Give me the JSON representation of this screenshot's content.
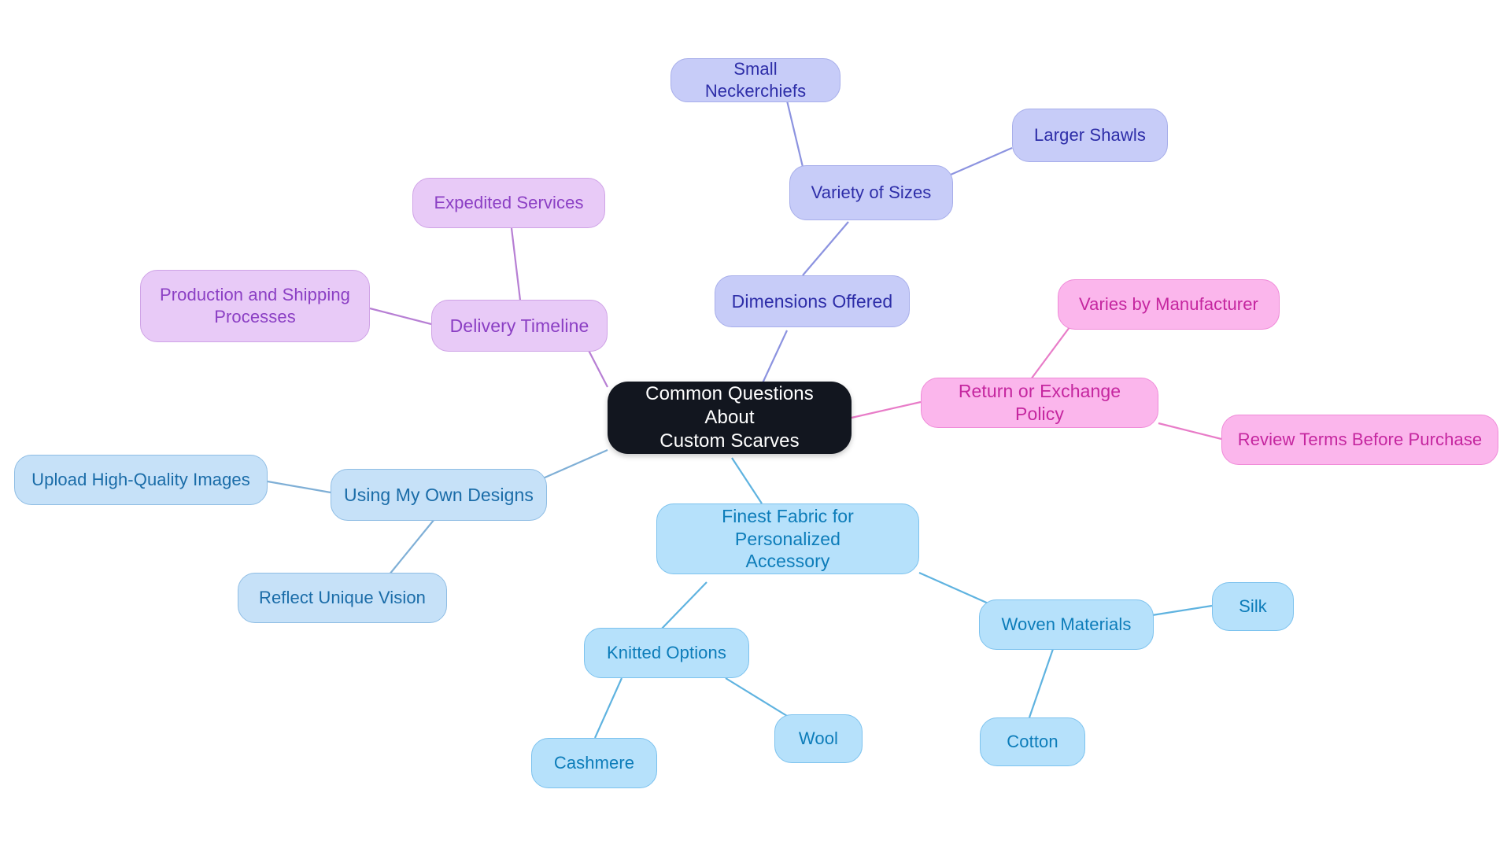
{
  "diagram": {
    "type": "mindmap",
    "title": "Common Questions About Custom Scarves",
    "background": "#ffffff",
    "palette": {
      "root_fill": "#12161f",
      "root_text": "#ffffff",
      "periwinkle_fill": "#c7ccf8",
      "periwinkle_text": "#2d2da8",
      "purple_fill": "#e8caf7",
      "purple_text": "#8b3fc4",
      "pink_fill": "#fbb6ec",
      "pink_text": "#c5269f",
      "blue_fill": "#c6e1f8",
      "blue_text": "#1a6ca8",
      "cyan_fill": "#b6e1fb",
      "cyan_text": "#0c7cb9"
    }
  },
  "nodes": {
    "root": {
      "label": "Common Questions About\nCustom Scarves"
    },
    "small_neckerchiefs": {
      "label": "Small Neckerchiefs"
    },
    "larger_shawls": {
      "label": "Larger Shawls"
    },
    "variety_of_sizes": {
      "label": "Variety of Sizes"
    },
    "dimensions_offered": {
      "label": "Dimensions Offered"
    },
    "expedited_services": {
      "label": "Expedited Services"
    },
    "production_shipping": {
      "label": "Production and Shipping\nProcesses"
    },
    "delivery_timeline": {
      "label": "Delivery Timeline"
    },
    "varies_by_manufacturer": {
      "label": "Varies by Manufacturer"
    },
    "return_exchange_policy": {
      "label": "Return or Exchange Policy"
    },
    "review_terms": {
      "label": "Review Terms Before Purchase"
    },
    "upload_images": {
      "label": "Upload High-Quality Images"
    },
    "own_designs": {
      "label": "Using My Own Designs"
    },
    "reflect_vision": {
      "label": "Reflect Unique Vision"
    },
    "finest_fabric": {
      "label": "Finest Fabric for Personalized\nAccessory"
    },
    "knitted_options": {
      "label": "Knitted Options"
    },
    "cashmere": {
      "label": "Cashmere"
    },
    "wool": {
      "label": "Wool"
    },
    "woven_materials": {
      "label": "Woven Materials"
    },
    "silk": {
      "label": "Silk"
    },
    "cotton": {
      "label": "Cotton"
    }
  },
  "branches": [
    {
      "name": "dimensions",
      "color": "#8c93e0",
      "root_child": "dimensions_offered",
      "children": [
        "variety_of_sizes"
      ],
      "grandchildren": [
        "small_neckerchiefs",
        "larger_shawls"
      ]
    },
    {
      "name": "delivery",
      "color": "#b77fd4",
      "root_child": "delivery_timeline",
      "children": [
        "expedited_services",
        "production_shipping"
      ],
      "grandchildren": []
    },
    {
      "name": "returns",
      "color": "#e87cc8",
      "root_child": "return_exchange_policy",
      "children": [
        "varies_by_manufacturer",
        "review_terms"
      ],
      "grandchildren": []
    },
    {
      "name": "designs",
      "color": "#7fafd6",
      "root_child": "own_designs",
      "children": [
        "upload_images",
        "reflect_vision"
      ],
      "grandchildren": []
    },
    {
      "name": "fabric",
      "color": "#5fb3e0",
      "root_child": "finest_fabric",
      "children": [
        "knitted_options",
        "woven_materials"
      ],
      "grandchildren": [
        "cashmere",
        "wool",
        "silk",
        "cotton"
      ]
    }
  ],
  "edges": [
    {
      "from": "root",
      "to": "delivery_timeline",
      "color": "#b77fd4"
    },
    {
      "from": "delivery_timeline",
      "to": "expedited_services",
      "color": "#b77fd4"
    },
    {
      "from": "delivery_timeline",
      "to": "production_shipping",
      "color": "#b77fd4"
    },
    {
      "from": "root",
      "to": "dimensions_offered",
      "color": "#8c93e0"
    },
    {
      "from": "dimensions_offered",
      "to": "variety_of_sizes",
      "color": "#8c93e0"
    },
    {
      "from": "variety_of_sizes",
      "to": "small_neckerchiefs",
      "color": "#8c93e0"
    },
    {
      "from": "variety_of_sizes",
      "to": "larger_shawls",
      "color": "#8c93e0"
    },
    {
      "from": "root",
      "to": "return_exchange_policy",
      "color": "#e87cc8"
    },
    {
      "from": "return_exchange_policy",
      "to": "varies_by_manufacturer",
      "color": "#e87cc8"
    },
    {
      "from": "return_exchange_policy",
      "to": "review_terms",
      "color": "#e87cc8"
    },
    {
      "from": "root",
      "to": "own_designs",
      "color": "#7fafd6"
    },
    {
      "from": "own_designs",
      "to": "upload_images",
      "color": "#7fafd6"
    },
    {
      "from": "own_designs",
      "to": "reflect_vision",
      "color": "#7fafd6"
    },
    {
      "from": "root",
      "to": "finest_fabric",
      "color": "#5fb3e0"
    },
    {
      "from": "finest_fabric",
      "to": "knitted_options",
      "color": "#5fb3e0"
    },
    {
      "from": "knitted_options",
      "to": "cashmere",
      "color": "#5fb3e0"
    },
    {
      "from": "knitted_options",
      "to": "wool",
      "color": "#5fb3e0"
    },
    {
      "from": "finest_fabric",
      "to": "woven_materials",
      "color": "#5fb3e0"
    },
    {
      "from": "woven_materials",
      "to": "silk",
      "color": "#5fb3e0"
    },
    {
      "from": "woven_materials",
      "to": "cotton",
      "color": "#5fb3e0"
    }
  ]
}
